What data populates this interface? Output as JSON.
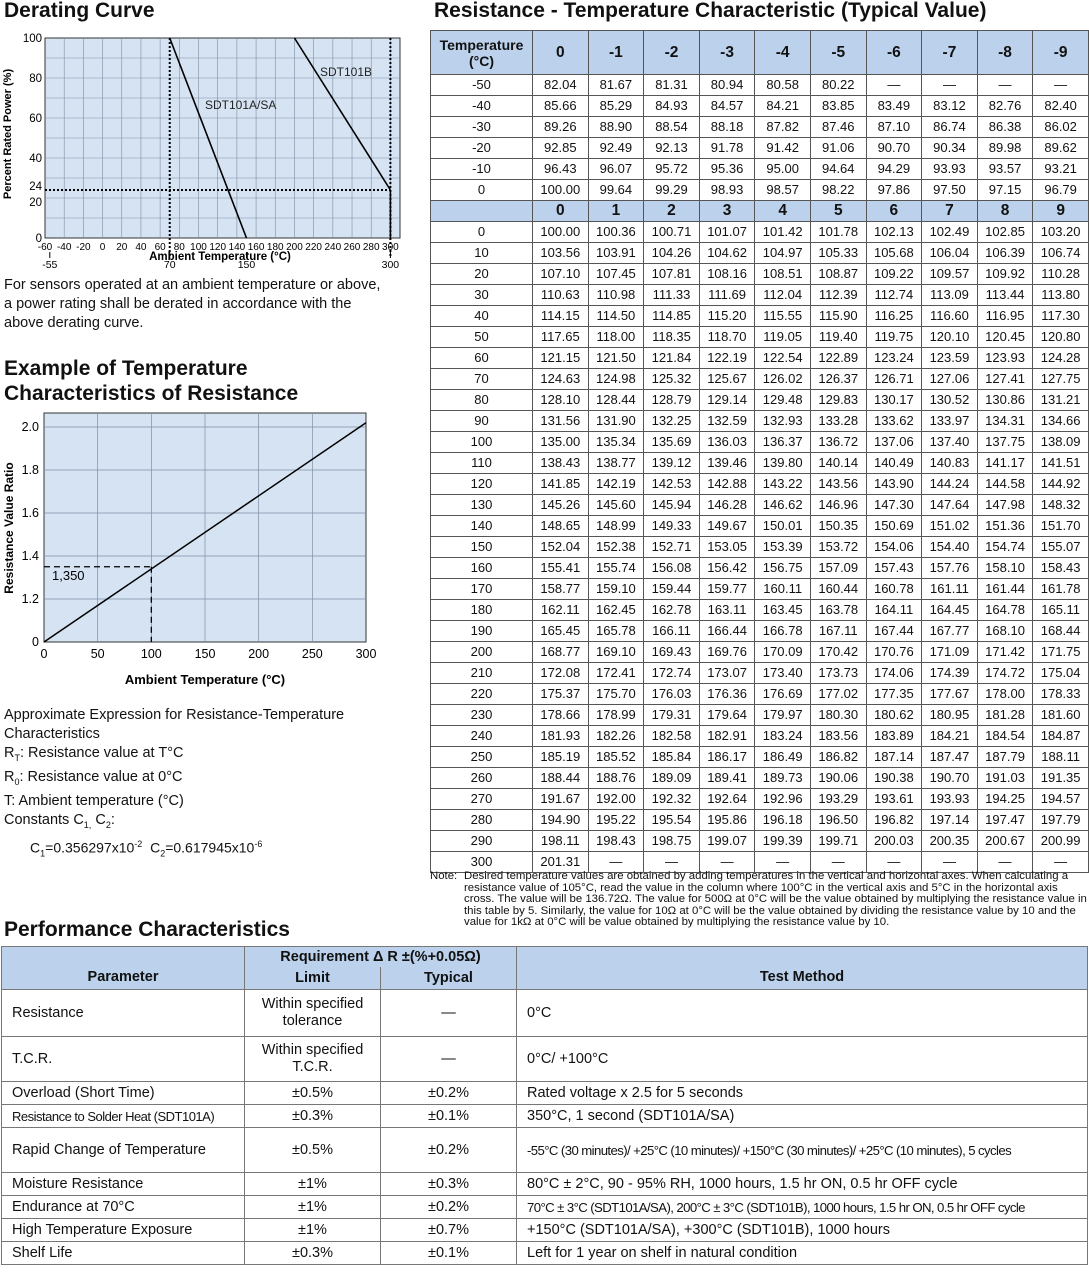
{
  "derating": {
    "title": "Derating Curve",
    "ylabel": "Percent Rated Power (%)",
    "xlabel": "Ambient Temperature (°C)",
    "y_ticks": [
      "100",
      "80",
      "60",
      "40",
      "24",
      "20",
      "0"
    ],
    "x_ticks": [
      "-60",
      "-40",
      "-20",
      "0",
      "20",
      "40",
      "60",
      "80",
      "100",
      "120",
      "140",
      "160",
      "180",
      "200",
      "220",
      "240",
      "260",
      "280",
      "300"
    ],
    "x_sub_ticks": [
      "-55",
      "70",
      "150",
      "300"
    ],
    "series_a": "SDT101A/SA",
    "series_b": "SDT101B",
    "description": "For sensors operated at an ambient temperature or above, a power rating shall be derated in accordance with the above derating curve."
  },
  "chart_data": [
    {
      "type": "line",
      "title": "Derating Curve",
      "xlabel": "Ambient Temperature (°C)",
      "ylabel": "Percent Rated Power (%)",
      "xlim": [
        -60,
        310
      ],
      "ylim": [
        0,
        100
      ],
      "grid": true,
      "series": [
        {
          "name": "SDT101A/SA",
          "x": [
            70,
            150
          ],
          "y": [
            100,
            0
          ]
        },
        {
          "name": "SDT101B",
          "x": [
            200,
            300
          ],
          "y": [
            100,
            24
          ]
        }
      ],
      "reference_lines": {
        "vertical": [
          70,
          300
        ],
        "horizontal": [
          24
        ]
      }
    },
    {
      "type": "line",
      "title": "Example of Temperature Characteristics of Resistance",
      "xlabel": "Ambient Temperature (°C)",
      "ylabel": "Resistance Value Ratio",
      "xlim": [
        0,
        300
      ],
      "ylim": [
        0,
        2.0
      ],
      "grid": true,
      "series": [
        {
          "x": [
            0,
            300
          ],
          "y": [
            1.0,
            2.02
          ]
        }
      ],
      "annotation": {
        "x": 100,
        "y": 1.35,
        "label": "1,350"
      }
    }
  ],
  "example": {
    "title_line1": "Example of Temperature",
    "title_line2": "Characteristics of Resistance",
    "ylabel": "Resistance Value Ratio",
    "xlabel": "Ambient Temperature (°C)",
    "y_ticks": [
      "2.0",
      "1.8",
      "1.6",
      "1.4",
      "1.2",
      "0"
    ],
    "x_ticks": [
      "0",
      "50",
      "100",
      "150",
      "200",
      "250",
      "300"
    ],
    "annotation": "1,350",
    "approx_line1": "Approximate Expression for Resistance-Temperature",
    "approx_line2": "Characteristics",
    "rt_def": ": Resistance value at T°C",
    "r0_def": ": Resistance value at 0°C",
    "t_def": "T: Ambient temperature (°C)",
    "constants_label": "Constants C",
    "constants_value_1": "C",
    "c1_val": "=0.356297x10",
    "c1_exp": "-2",
    "c2_val": "=0.617945x10",
    "c2_exp": "-6"
  },
  "rt_table": {
    "title": "Resistance - Temperature Characteristic (Typical Value)",
    "corner_line1": "Temperature",
    "corner_line2": "(°C)",
    "neg_headers": [
      "0",
      "-1",
      "-2",
      "-3",
      "-4",
      "-5",
      "-6",
      "-7",
      "-8",
      "-9"
    ],
    "neg_rows": [
      {
        "t": "-50",
        "v": [
          "82.04",
          "81.67",
          "81.31",
          "80.94",
          "80.58",
          "80.22",
          "—",
          "—",
          "—",
          "—"
        ]
      },
      {
        "t": "-40",
        "v": [
          "85.66",
          "85.29",
          "84.93",
          "84.57",
          "84.21",
          "83.85",
          "83.49",
          "83.12",
          "82.76",
          "82.40"
        ]
      },
      {
        "t": "-30",
        "v": [
          "89.26",
          "88.90",
          "88.54",
          "88.18",
          "87.82",
          "87.46",
          "87.10",
          "86.74",
          "86.38",
          "86.02"
        ]
      },
      {
        "t": "-20",
        "v": [
          "92.85",
          "92.49",
          "92.13",
          "91.78",
          "91.42",
          "91.06",
          "90.70",
          "90.34",
          "89.98",
          "89.62"
        ]
      },
      {
        "t": "-10",
        "v": [
          "96.43",
          "96.07",
          "95.72",
          "95.36",
          "95.00",
          "94.64",
          "94.29",
          "93.93",
          "93.57",
          "93.21"
        ]
      },
      {
        "t": "0",
        "v": [
          "100.00",
          "99.64",
          "99.29",
          "98.93",
          "98.57",
          "98.22",
          "97.86",
          "97.50",
          "97.15",
          "96.79"
        ]
      }
    ],
    "pos_headers": [
      "0",
      "1",
      "2",
      "3",
      "4",
      "5",
      "6",
      "7",
      "8",
      "9"
    ],
    "pos_rows": [
      {
        "t": "0",
        "v": [
          "100.00",
          "100.36",
          "100.71",
          "101.07",
          "101.42",
          "101.78",
          "102.13",
          "102.49",
          "102.85",
          "103.20"
        ]
      },
      {
        "t": "10",
        "v": [
          "103.56",
          "103.91",
          "104.26",
          "104.62",
          "104.97",
          "105.33",
          "105.68",
          "106.04",
          "106.39",
          "106.74"
        ]
      },
      {
        "t": "20",
        "v": [
          "107.10",
          "107.45",
          "107.81",
          "108.16",
          "108.51",
          "108.87",
          "109.22",
          "109.57",
          "109.92",
          "110.28"
        ]
      },
      {
        "t": "30",
        "v": [
          "110.63",
          "110.98",
          "111.33",
          "111.69",
          "112.04",
          "112.39",
          "112.74",
          "113.09",
          "113.44",
          "113.80"
        ]
      },
      {
        "t": "40",
        "v": [
          "114.15",
          "114.50",
          "114.85",
          "115.20",
          "115.55",
          "115.90",
          "116.25",
          "116.60",
          "116.95",
          "117.30"
        ]
      },
      {
        "t": "50",
        "v": [
          "117.65",
          "118.00",
          "118.35",
          "118.70",
          "119.05",
          "119.40",
          "119.75",
          "120.10",
          "120.45",
          "120.80"
        ]
      },
      {
        "t": "60",
        "v": [
          "121.15",
          "121.50",
          "121.84",
          "122.19",
          "122.54",
          "122.89",
          "123.24",
          "123.59",
          "123.93",
          "124.28"
        ]
      },
      {
        "t": "70",
        "v": [
          "124.63",
          "124.98",
          "125.32",
          "125.67",
          "126.02",
          "126.37",
          "126.71",
          "127.06",
          "127.41",
          "127.75"
        ]
      },
      {
        "t": "80",
        "v": [
          "128.10",
          "128.44",
          "128.79",
          "129.14",
          "129.48",
          "129.83",
          "130.17",
          "130.52",
          "130.86",
          "131.21"
        ]
      },
      {
        "t": "90",
        "v": [
          "131.56",
          "131.90",
          "132.25",
          "132.59",
          "132.93",
          "133.28",
          "133.62",
          "133.97",
          "134.31",
          "134.66"
        ]
      },
      {
        "t": "100",
        "v": [
          "135.00",
          "135.34",
          "135.69",
          "136.03",
          "136.37",
          "136.72",
          "137.06",
          "137.40",
          "137.75",
          "138.09"
        ]
      },
      {
        "t": "110",
        "v": [
          "138.43",
          "138.77",
          "139.12",
          "139.46",
          "139.80",
          "140.14",
          "140.49",
          "140.83",
          "141.17",
          "141.51"
        ]
      },
      {
        "t": "120",
        "v": [
          "141.85",
          "142.19",
          "142.53",
          "142.88",
          "143.22",
          "143.56",
          "143.90",
          "144.24",
          "144.58",
          "144.92"
        ]
      },
      {
        "t": "130",
        "v": [
          "145.26",
          "145.60",
          "145.94",
          "146.28",
          "146.62",
          "146.96",
          "147.30",
          "147.64",
          "147.98",
          "148.32"
        ]
      },
      {
        "t": "140",
        "v": [
          "148.65",
          "148.99",
          "149.33",
          "149.67",
          "150.01",
          "150.35",
          "150.69",
          "151.02",
          "151.36",
          "151.70"
        ]
      },
      {
        "t": "150",
        "v": [
          "152.04",
          "152.38",
          "152.71",
          "153.05",
          "153.39",
          "153.72",
          "154.06",
          "154.40",
          "154.74",
          "155.07"
        ]
      },
      {
        "t": "160",
        "v": [
          "155.41",
          "155.74",
          "156.08",
          "156.42",
          "156.75",
          "157.09",
          "157.43",
          "157.76",
          "158.10",
          "158.43"
        ]
      },
      {
        "t": "170",
        "v": [
          "158.77",
          "159.10",
          "159.44",
          "159.77",
          "160.11",
          "160.44",
          "160.78",
          "161.11",
          "161.44",
          "161.78"
        ]
      },
      {
        "t": "180",
        "v": [
          "162.11",
          "162.45",
          "162.78",
          "163.11",
          "163.45",
          "163.78",
          "164.11",
          "164.45",
          "164.78",
          "165.11"
        ]
      },
      {
        "t": "190",
        "v": [
          "165.45",
          "165.78",
          "166.11",
          "166.44",
          "166.78",
          "167.11",
          "167.44",
          "167.77",
          "168.10",
          "168.44"
        ]
      },
      {
        "t": "200",
        "v": [
          "168.77",
          "169.10",
          "169.43",
          "169.76",
          "170.09",
          "170.42",
          "170.76",
          "171.09",
          "171.42",
          "171.75"
        ]
      },
      {
        "t": "210",
        "v": [
          "172.08",
          "172.41",
          "172.74",
          "173.07",
          "173.40",
          "173.73",
          "174.06",
          "174.39",
          "174.72",
          "175.04"
        ]
      },
      {
        "t": "220",
        "v": [
          "175.37",
          "175.70",
          "176.03",
          "176.36",
          "176.69",
          "177.02",
          "177.35",
          "177.67",
          "178.00",
          "178.33"
        ]
      },
      {
        "t": "230",
        "v": [
          "178.66",
          "178.99",
          "179.31",
          "179.64",
          "179.97",
          "180.30",
          "180.62",
          "180.95",
          "181.28",
          "181.60"
        ]
      },
      {
        "t": "240",
        "v": [
          "181.93",
          "182.26",
          "182.58",
          "182.91",
          "183.24",
          "183.56",
          "183.89",
          "184.21",
          "184.54",
          "184.87"
        ]
      },
      {
        "t": "250",
        "v": [
          "185.19",
          "185.52",
          "185.84",
          "186.17",
          "186.49",
          "186.82",
          "187.14",
          "187.47",
          "187.79",
          "188.11"
        ]
      },
      {
        "t": "260",
        "v": [
          "188.44",
          "188.76",
          "189.09",
          "189.41",
          "189.73",
          "190.06",
          "190.38",
          "190.70",
          "191.03",
          "191.35"
        ]
      },
      {
        "t": "270",
        "v": [
          "191.67",
          "192.00",
          "192.32",
          "192.64",
          "192.96",
          "193.29",
          "193.61",
          "193.93",
          "194.25",
          "194.57"
        ]
      },
      {
        "t": "280",
        "v": [
          "194.90",
          "195.22",
          "195.54",
          "195.86",
          "196.18",
          "196.50",
          "196.82",
          "197.14",
          "197.47",
          "197.79"
        ]
      },
      {
        "t": "290",
        "v": [
          "198.11",
          "198.43",
          "198.75",
          "199.07",
          "199.39",
          "199.71",
          "200.03",
          "200.35",
          "200.67",
          "200.99"
        ]
      },
      {
        "t": "300",
        "v": [
          "201.31",
          "—",
          "—",
          "—",
          "—",
          "—",
          "—",
          "—",
          "—",
          "—"
        ]
      }
    ],
    "note_label": "Note:",
    "note_text": "Desired temperature values are obtained by adding temperatures in the vertical and horizontal axes. When calculating a resistance value of 105°C, read the value in the column where 100°C in the vertical axis and 5°C in the horizontal axis cross. The value will be 136.72Ω. The value for 500Ω at 0°C will be the value obtained by multiplying the resistance value in this table by 5. Similarly, the value for 10Ω at 0°C will be the value obtained by dividing the resistance value by 10 and the value for 1kΩ at 0°C will be value obtained by multiplying the resistance value by 10."
  },
  "performance": {
    "title": "Performance Characteristics",
    "h_parameter": "Parameter",
    "h_requirement": "Requirement Δ R ±(%+0.05Ω)",
    "h_limit": "Limit",
    "h_typical": "Typical",
    "h_test": "Test Method",
    "rows": [
      {
        "param": "Resistance",
        "limit": "Within specified tolerance",
        "typical": "—",
        "test": "0°C"
      },
      {
        "param": "T.C.R.",
        "limit": "Within specified T.C.R.",
        "typical": "—",
        "test": "0°C/ +100°C"
      },
      {
        "param": "Overload (Short Time)",
        "limit": "±0.5%",
        "typical": "±0.2%",
        "test": "Rated voltage x 2.5 for 5 seconds"
      },
      {
        "param": "Resistance to Solder Heat (SDT101A)",
        "limit": "±0.3%",
        "typical": "±0.1%",
        "test": "350°C, 1 second (SDT101A/SA)"
      },
      {
        "param": "Rapid Change of Temperature",
        "limit": "±0.5%",
        "typical": "±0.2%",
        "test": "-55°C (30 minutes)/ +25°C (10 minutes)/ +150°C (30 minutes)/ +25°C (10 minutes), 5 cycles"
      },
      {
        "param": "Moisture Resistance",
        "limit": "±1%",
        "typical": "±0.3%",
        "test": "80°C ± 2°C, 90 - 95% RH, 1000 hours, 1.5 hr ON, 0.5 hr OFF cycle"
      },
      {
        "param": "Endurance at 70°C",
        "limit": "±1%",
        "typical": "±0.2%",
        "test": "70°C ± 3°C (SDT101A/SA), 200°C ± 3°C (SDT101B), 1000 hours, 1.5 hr ON, 0.5 hr OFF cycle"
      },
      {
        "param": "High Temperature Exposure",
        "limit": "±1%",
        "typical": "±0.7%",
        "test": "+150°C (SDT101A/SA), +300°C (SDT101B), 1000 hours"
      },
      {
        "param": "Shelf Life",
        "limit": "±0.3%",
        "typical": "±0.1%",
        "test": "Left for 1 year on shelf in natural condition"
      }
    ]
  }
}
